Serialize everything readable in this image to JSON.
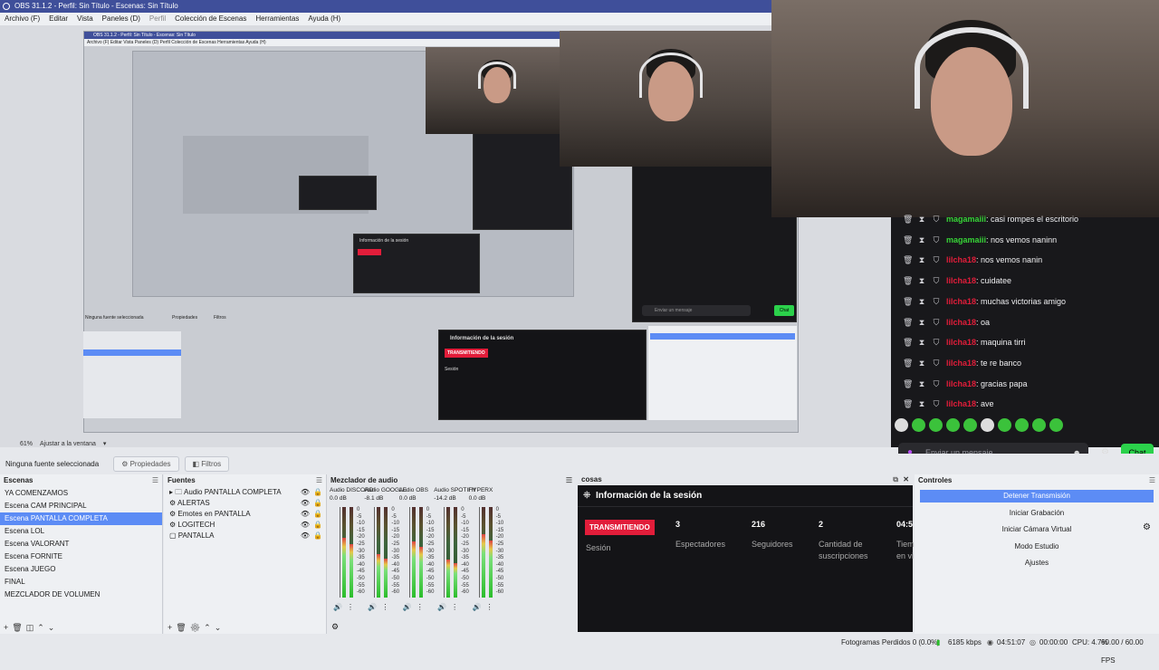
{
  "window": {
    "title": "OBS 31.1.2 - Perfil: Sin Título - Escenas: Sin Título"
  },
  "menu": {
    "items": [
      "Archivo (F)",
      "Editar",
      "Vista",
      "Paneles (D)",
      "Perfil",
      "Colección de Escenas",
      "Herramientas",
      "Ayuda (H)"
    ]
  },
  "nested": {
    "title": "OBS 31.1.2 - Perfil: Sin Título - Escenas: Sin Título",
    "menu": "Archivo (F)   Editar   Vista   Paneles (D)   Perfil   Colección de Escenas   Herramientas   Ayuda (H)",
    "source_status": "Ninguna fuente seleccionada",
    "props": "Propiedades",
    "filters": "Filtros",
    "session_title": "Información de la sesión",
    "live": "TRANSMITIENDO",
    "sesion": "Sesión",
    "chat_placeholder": "Enviar un mensaje",
    "chat_btn": "Chat"
  },
  "chat": {
    "lines": [
      {
        "user": "magamaiii",
        "text": ": casi rompes el escritorio",
        "color": "#37d437"
      },
      {
        "user": "magamaiii",
        "text": ": nos vemos naninn",
        "color": "#37d437"
      },
      {
        "user": "lilcha18",
        "text": ": nos vemos nanin",
        "color": "#e21d3a"
      },
      {
        "user": "lilcha18",
        "text": ": cuidatee",
        "color": "#e21d3a"
      },
      {
        "user": "lilcha18",
        "text": ": muchas victorias amigo",
        "color": "#e21d3a"
      },
      {
        "user": "lilcha18",
        "text": ": oa",
        "color": "#e21d3a"
      },
      {
        "user": "lilcha18",
        "text": ": maquina tirri",
        "color": "#e21d3a"
      },
      {
        "user": "lilcha18",
        "text": ": te re banco",
        "color": "#e21d3a"
      },
      {
        "user": "lilcha18",
        "text": ": gracias papa",
        "color": "#e21d3a"
      },
      {
        "user": "lilcha18",
        "text": ": ave",
        "color": "#e21d3a"
      }
    ],
    "placeholder": "Enviar un mensaje",
    "button": "Chat"
  },
  "zoom": {
    "value": "61%",
    "fit": "Ajustar a la ventana"
  },
  "source_bar": {
    "status": "Ninguna fuente seleccionada",
    "properties": "Propiedades",
    "filters": "Filtros"
  },
  "scenes": {
    "title": "Escenas",
    "items": [
      "YA COMENZAMOS",
      "Escena CAM PRINCIPAL",
      "Escena PANTALLA COMPLETA",
      "Escena LOL",
      "Escena VALORANT",
      "Escena FORNITE",
      "Escena JUEGO",
      "FINAL",
      "MEZCLADOR DE VOLUMEN"
    ],
    "selected": 2
  },
  "sources": {
    "title": "Fuentes",
    "items": [
      "Audio PANTALLA COMPLETA",
      "ALERTAS",
      "Emotes en PANTALLA",
      "LOGITECH",
      "PANTALLA"
    ]
  },
  "mixer": {
    "title": "Mezclador de audio",
    "channels": [
      {
        "name": "Audio DISCORD",
        "db": "0.0 dB",
        "level": 0.66
      },
      {
        "name": "Audio GOOGLE",
        "db": "-8.1 dB",
        "level": 0.48
      },
      {
        "name": "Audio OBS",
        "db": "0.0 dB",
        "level": 0.62
      },
      {
        "name": "Audio SPOTIFY",
        "db": "-14.2 dB",
        "level": 0.42
      },
      {
        "name": "HYPERX",
        "db": "0.0 dB",
        "level": 0.7
      }
    ],
    "scale": [
      "0",
      "-5",
      "-10",
      "-15",
      "-20",
      "-25",
      "-30",
      "-35",
      "-40",
      "-45",
      "-50",
      "-55",
      "-60"
    ]
  },
  "session": {
    "dock_title": "cosas",
    "title": "Información de la sesión",
    "live": "TRANSMITIENDO",
    "session_label": "Sesión",
    "stats": [
      {
        "value": "3",
        "label": "Espectadores"
      },
      {
        "value": "216",
        "label": "Seguidores"
      },
      {
        "value": "2",
        "label": "Cantidad de suscripciones"
      },
      {
        "value": "04:5",
        "label": "Tiem en vi"
      }
    ]
  },
  "controls": {
    "title": "Controles",
    "buttons": [
      "Detener Transmisión",
      "Iniciar Grabación",
      "Iniciar Cámara Virtual",
      "Modo Estudio",
      "Ajustes"
    ]
  },
  "status": {
    "dropped": "Fotogramas Perdidos 0 (0.0%)",
    "bitrate": "6185 kbps",
    "live_time": "04:51:07",
    "rec_time": "00:00:00",
    "cpu": "CPU: 4.7%",
    "fps": "60.00 / 60.00 FPS"
  }
}
